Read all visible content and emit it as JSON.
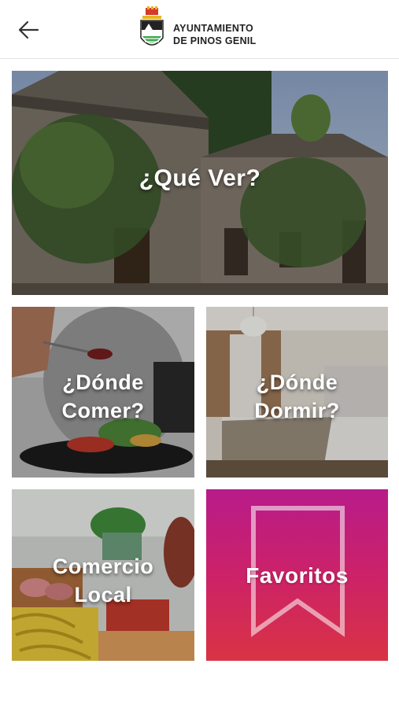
{
  "header": {
    "back_icon": "arrow-left-icon",
    "logo_icon": "town-coat-of-arms-icon",
    "org_line1": "AYUNTAMIENTO",
    "org_line2": "DE PINOS GENIL"
  },
  "tiles": [
    {
      "label": "¿Qué Ver?",
      "image": "stone-buildings-photo"
    },
    {
      "label_line1": "¿Dónde",
      "label_line2": "Comer?",
      "image": "plated-food-photo"
    },
    {
      "label_line1": "¿Dónde",
      "label_line2": "Dormir?",
      "image": "hotel-bedroom-photo"
    },
    {
      "label_line1": "Comercio",
      "label_line2": "Local",
      "image": "fruit-market-photo"
    },
    {
      "label": "Favoritos",
      "image": "bookmark-icon",
      "colors": [
        "#b81b8a",
        "#d93344"
      ]
    }
  ]
}
